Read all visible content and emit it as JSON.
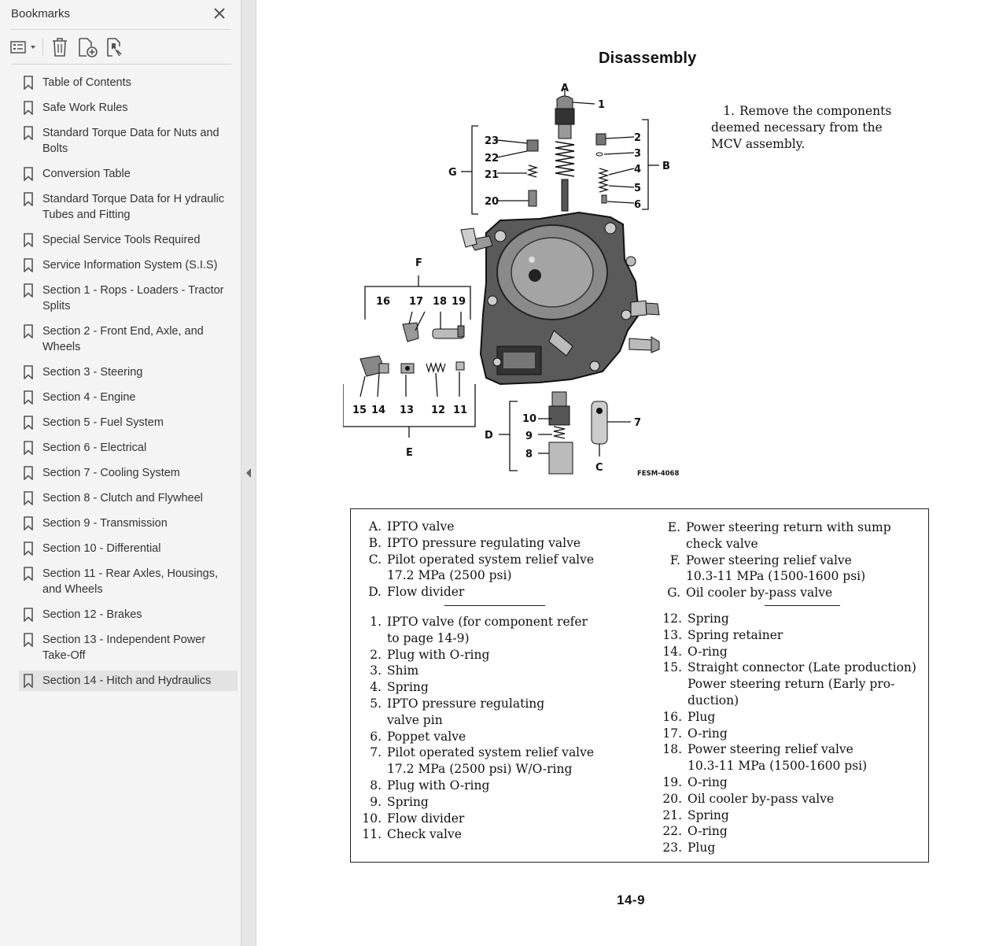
{
  "sidebar": {
    "title": "Bookmarks",
    "bookmarks": [
      "Table of Contents",
      "Safe Work Rules",
      "Standard Torque Data for Nuts and Bolts",
      "Conversion Table",
      "Standard Torque Data for H ydraulic Tubes and Fitting",
      "Special Service Tools Required",
      "Service Information System (S.I.S)",
      "Section 1 - Rops - Loaders - Tractor Splits",
      "Section 2 - Front End, Axle, and Wheels",
      "Section 3 - Steering",
      "Section 4 - Engine",
      "Section 5 - Fuel System",
      "Section 6 - Electrical",
      "Section 7 - Cooling System",
      "Section 8 - Clutch and Flywheel",
      "Section 9 - Transmission",
      "Section 10 - Differential",
      "Section 11 - Rear Axles, Housings, and Wheels",
      "Section 12 - Brakes",
      "Section 13 - Independent Power Take-Off",
      "Section 14 - Hitch and Hydraulics"
    ],
    "selected_index": 20
  },
  "page": {
    "title": "Disassembly",
    "step_number": "1.",
    "step_text": "Remove the components deemed necessary from the MCV assembly.",
    "figure_code": "FESM-4068",
    "page_number": "14-9"
  },
  "figure_labels": {
    "letters": [
      "A",
      "B",
      "C",
      "D",
      "E",
      "F",
      "G"
    ],
    "numbers": [
      "1",
      "2",
      "3",
      "4",
      "5",
      "6",
      "7",
      "8",
      "9",
      "10",
      "11",
      "12",
      "13",
      "14",
      "15",
      "16",
      "17",
      "18",
      "19",
      "20",
      "21",
      "22",
      "23"
    ]
  },
  "legend": {
    "letter_col1": [
      {
        "k": "A.",
        "t": "IPTO valve"
      },
      {
        "k": "B.",
        "t": "IPTO pressure regulating valve"
      },
      {
        "k": "C.",
        "t": "Pilot operated system relief valve"
      },
      {
        "k": "",
        "t": "17.2 MPa (2500 psi)"
      },
      {
        "k": "D.",
        "t": "Flow divider"
      }
    ],
    "letter_col2": [
      {
        "k": "E.",
        "t": "Power steering return with sump"
      },
      {
        "k": "",
        "t": "check valve"
      },
      {
        "k": "F.",
        "t": "Power steering relief valve"
      },
      {
        "k": "",
        "t": "10.3-11 MPa (1500-1600 psi)"
      },
      {
        "k": "G.",
        "t": "Oil cooler by-pass valve"
      }
    ],
    "num_col1": [
      {
        "k": "1.",
        "t": "IPTO valve (for component refer"
      },
      {
        "k": "",
        "t": "to page 14-9)"
      },
      {
        "k": "2.",
        "t": "Plug with O-ring"
      },
      {
        "k": "3.",
        "t": "Shim"
      },
      {
        "k": "4.",
        "t": "Spring"
      },
      {
        "k": "5.",
        "t": "IPTO pressure regulating"
      },
      {
        "k": "",
        "t": "valve pin"
      },
      {
        "k": "6.",
        "t": "Poppet valve"
      },
      {
        "k": "7.",
        "t": "Pilot operated system relief valve"
      },
      {
        "k": "",
        "t": "17.2 MPa (2500 psi) W/O-ring"
      },
      {
        "k": "8.",
        "t": "Plug with O-ring"
      },
      {
        "k": "9.",
        "t": "Spring"
      },
      {
        "k": "10.",
        "t": "Flow divider"
      },
      {
        "k": "11.",
        "t": "Check valve"
      }
    ],
    "num_col2": [
      {
        "k": "12.",
        "t": "Spring"
      },
      {
        "k": "13.",
        "t": "Spring retainer"
      },
      {
        "k": "14.",
        "t": "O-ring"
      },
      {
        "k": "15.",
        "t": "Straight connector (Late production)"
      },
      {
        "k": "",
        "t": "Power steering return (Early pro-"
      },
      {
        "k": "",
        "t": "duction)"
      },
      {
        "k": "16.",
        "t": "Plug"
      },
      {
        "k": "17.",
        "t": "O-ring"
      },
      {
        "k": "18.",
        "t": "Power steering relief valve"
      },
      {
        "k": "",
        "t": "10.3-11 MPa (1500-1600 psi)"
      },
      {
        "k": "19.",
        "t": "O-ring"
      },
      {
        "k": "20.",
        "t": "Oil cooler by-pass valve"
      },
      {
        "k": "21.",
        "t": "Spring"
      },
      {
        "k": "22.",
        "t": "O-ring"
      },
      {
        "k": "23.",
        "t": "Plug"
      }
    ]
  }
}
